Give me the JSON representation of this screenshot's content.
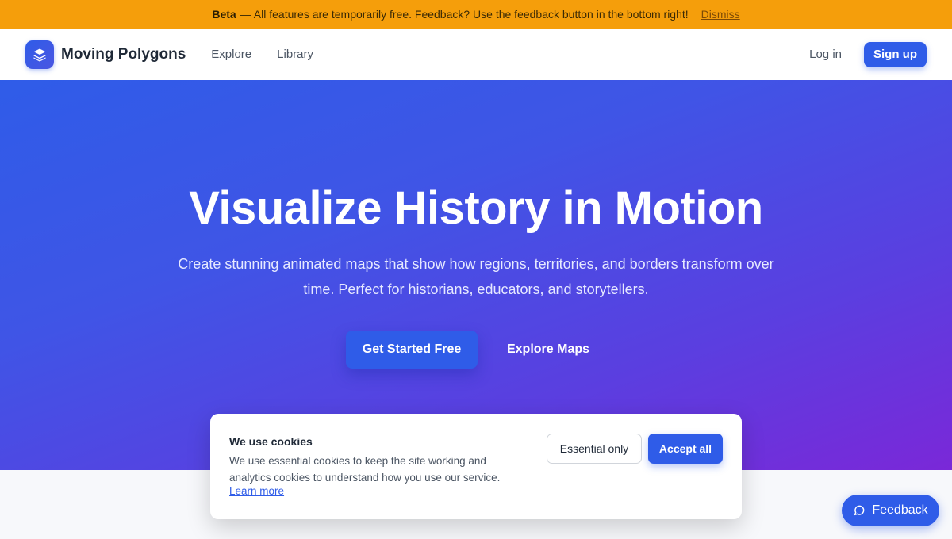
{
  "banner": {
    "label": "Beta",
    "message": "— All features are temporarily free. Feedback? Use the feedback button in the bottom right!",
    "dismiss": "Dismiss",
    "color": "#f59e0b"
  },
  "nav": {
    "brand": "Moving Polygons",
    "logo_icon": "layers-icon",
    "links": [
      "Explore",
      "Library"
    ],
    "login": "Log in",
    "signup": "Sign up"
  },
  "hero": {
    "title": "Visualize History in Motion",
    "subtitle": "Create stunning animated maps that show how regions, territories, and borders transform over time. Perfect for historians, educators, and storytellers.",
    "primary_cta": "Get Started Free",
    "secondary_cta": "Explore Maps",
    "gradient_start": "#2f5ce8",
    "gradient_end": "#7a28d8"
  },
  "cookie_banner": {
    "title": "We use cookies",
    "description": "We use essential cookies to keep the site working and analytics cookies to understand how you use our service.",
    "learn_more": "Learn more",
    "essential_button": "Essential only",
    "accept_button": "Accept all"
  },
  "feedback": {
    "label": "Feedback",
    "icon": "chat-bubble-icon"
  },
  "colors": {
    "accent": "#2f5ce8"
  }
}
